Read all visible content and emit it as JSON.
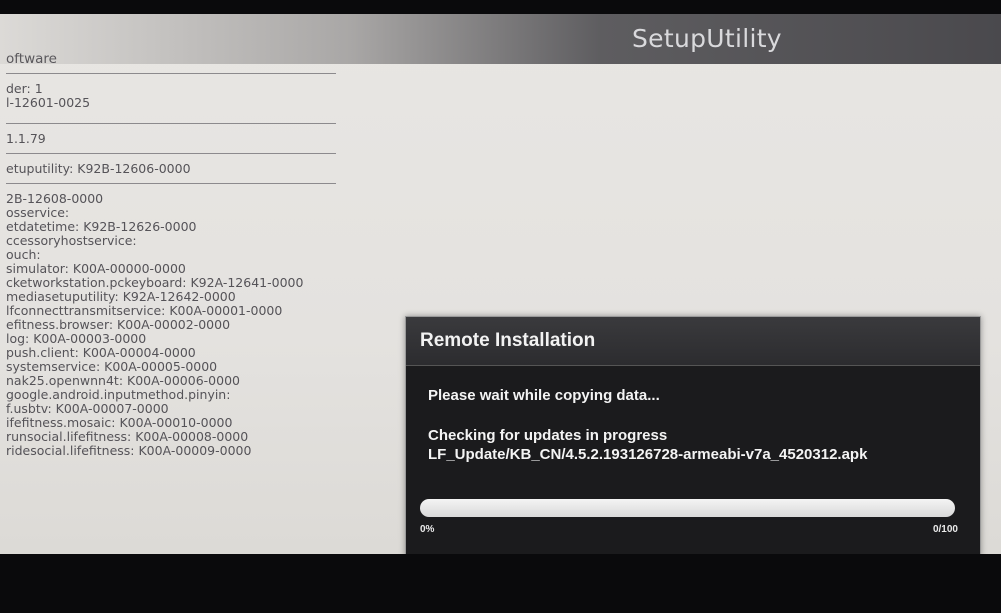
{
  "app": {
    "title": "SetupUtility"
  },
  "info_panel": {
    "heading": "oftware",
    "lines": [
      "der: 1",
      "l-12601-0025",
      "1.1.79",
      "etuputility: K92B-12606-0000",
      "2B-12608-0000",
      "osservice:",
      "etdatetime: K92B-12626-0000",
      "ccessoryhostservice:",
      "ouch:",
      "simulator: K00A-00000-0000",
      "cketworkstation.pckeyboard: K92A-12641-0000",
      "mediasetuputility: K92A-12642-0000",
      "lfconnecttransmitservice: K00A-00001-0000",
      "efitness.browser: K00A-00002-0000",
      "log: K00A-00003-0000",
      "push.client: K00A-00004-0000",
      "systemservice: K00A-00005-0000",
      "nak25.openwnn4t: K00A-00006-0000",
      "google.android.inputmethod.pinyin:",
      "f.usbtv: K00A-00007-0000",
      "ifefitness.mosaic: K00A-00010-0000",
      "runsocial.lifefitness: K00A-00008-0000",
      "ridesocial.lifefitness: K00A-00009-0000"
    ]
  },
  "dialog": {
    "title": "Remote Installation",
    "wait_message": "Please wait while copying data...",
    "status": "Checking for updates in progress",
    "file_path": "LF_Update/KB_CN/4.5.2.193126728-armeabi-v7a_4520312.apk",
    "progress": {
      "value": 0,
      "left_label": "0%",
      "right_label": "0/100",
      "fill_color": "#4caf50"
    }
  }
}
